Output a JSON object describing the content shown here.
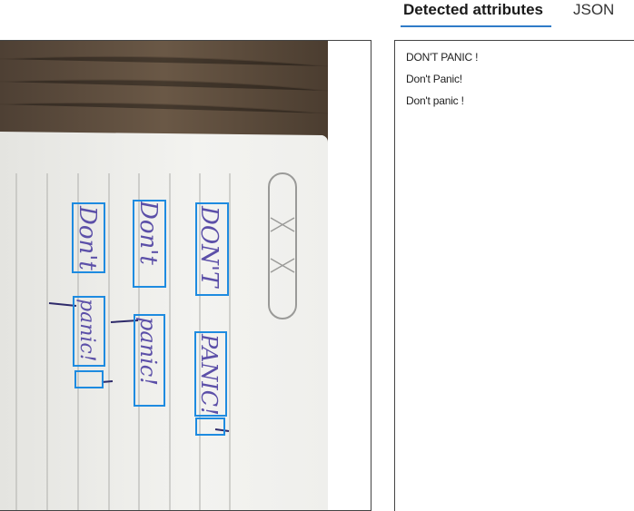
{
  "tabs": [
    {
      "label": "Detected attributes",
      "active": true
    },
    {
      "label": "JSON",
      "active": false
    }
  ],
  "results": [
    "DON'T PANIC !",
    "Don't Panic!",
    "Don't panic !"
  ],
  "handwriting": {
    "col1_top": "Don't",
    "col1_bottom": "panic!",
    "col2_top": "Don't",
    "col2_bottom": "panic!",
    "col3_top": "DON'T",
    "col3_bottom": "PANIC!"
  },
  "colors": {
    "accent": "#2f7bc8",
    "box": "#1e8be0",
    "ink": "#5b4fa8",
    "wood": "#5a4a3a",
    "paper": "#f2f2ef"
  }
}
